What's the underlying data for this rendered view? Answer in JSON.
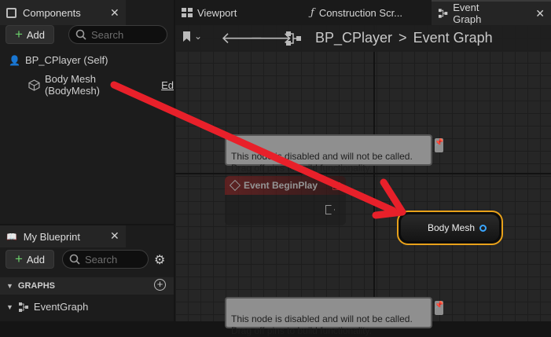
{
  "components_panel": {
    "title": "Components",
    "add_label": "Add",
    "search_placeholder": "Search",
    "items": [
      {
        "label": "BP_CPlayer (Self)"
      },
      {
        "label": "Body Mesh (BodyMesh)",
        "suffix": "Ed"
      }
    ]
  },
  "blueprint_panel": {
    "title": "My Blueprint",
    "add_label": "Add",
    "search_placeholder": "Search",
    "section_title": "GRAPHS",
    "graph_item": "EventGraph"
  },
  "editor_tabs": [
    {
      "label": "Viewport"
    },
    {
      "label": "Construction Scr..."
    },
    {
      "label": "Event Graph"
    }
  ],
  "breadcrumb": {
    "root": "BP_CPlayer",
    "separator": ">",
    "current": "Event Graph"
  },
  "graph": {
    "comment_top": "This node is disabled and will not be called.\nDrag off pins to build functionality.",
    "comment_bottom": "This node is disabled and will not be called.\nDrag off pins to build functionality.",
    "event_node_title": "Event BeginPlay",
    "variable_node_label": "Body Mesh"
  },
  "colors": {
    "annotation_arrow": "#e8202a",
    "node_highlight": "#e8a11a",
    "event_header": "#7a1d1d",
    "pin_blue": "#3aa6ff"
  }
}
